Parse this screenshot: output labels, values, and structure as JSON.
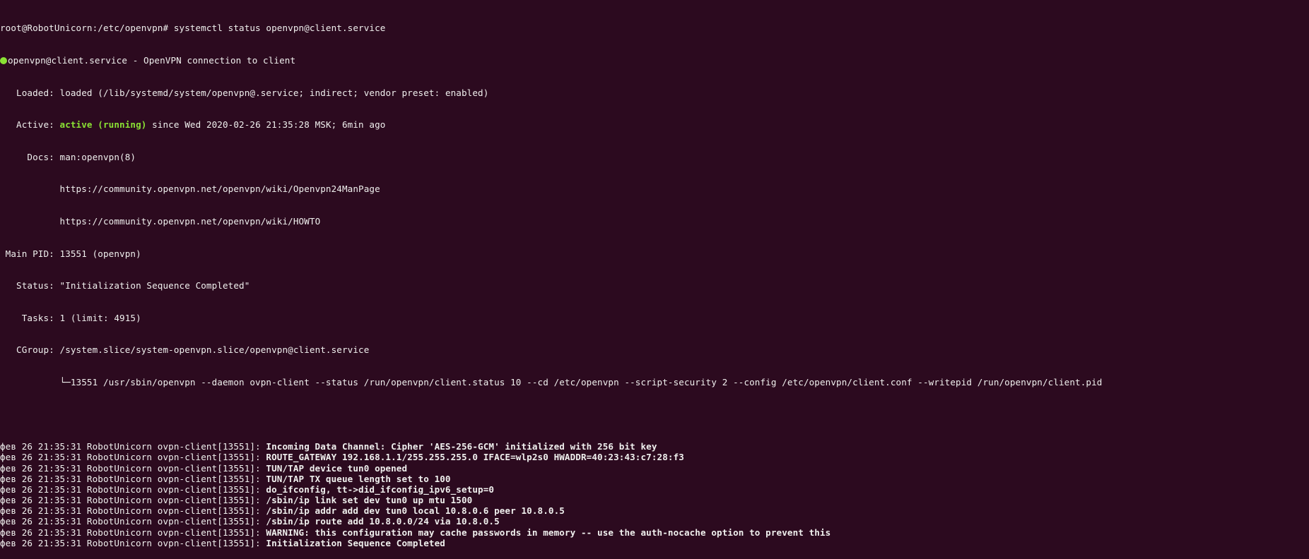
{
  "prompt": "root@RobotUnicorn:/etc/openvpn# ",
  "command": "systemctl status openvpn@client.service",
  "status_color": "#8ae234",
  "service": {
    "status_icon": "green-dot-icon",
    "header": "openvpn@client.service - OpenVPN connection to client",
    "loaded_label": "   Loaded: ",
    "loaded": "loaded (/lib/systemd/system/openvpn@.service; indirect; vendor preset: enabled)",
    "active_label": "   Active: ",
    "active_state": "active (running)",
    "active_since": " since Wed 2020-02-26 21:35:28 MSK; 6min ago",
    "docs_label": "     Docs: ",
    "docs": [
      "man:openvpn(8)",
      "https://community.openvpn.net/openvpn/wiki/Openvpn24ManPage",
      "https://community.openvpn.net/openvpn/wiki/HOWTO"
    ],
    "docs_indent": "           ",
    "main_pid_label": " Main PID: ",
    "main_pid": "13551 (openvpn)",
    "status_label": "   Status: ",
    "status": "\"Initialization Sequence Completed\"",
    "tasks_label": "    Tasks: ",
    "tasks": "1 (limit: 4915)",
    "cgroup_label": "   CGroup: ",
    "cgroup": "/system.slice/system-openvpn.slice/openvpn@client.service",
    "cgroup_process": "           └─13551 /usr/sbin/openvpn --daemon ovpn-client --status /run/openvpn/client.status 10 --cd /etc/openvpn --script-security 2 --config /etc/openvpn/client.conf --writepid /run/openvpn/client.pid"
  },
  "log_prefix": "фев 26 21:35:31 RobotUnicorn ovpn-client[13551]: ",
  "log": [
    "Incoming Data Channel: Cipher 'AES-256-GCM' initialized with 256 bit key",
    "ROUTE_GATEWAY 192.168.1.1/255.255.255.0 IFACE=wlp2s0 HWADDR=40:23:43:c7:28:f3",
    "TUN/TAP device tun0 opened",
    "TUN/TAP TX queue length set to 100",
    "do_ifconfig, tt->did_ifconfig_ipv6_setup=0",
    "/sbin/ip link set dev tun0 up mtu 1500",
    "/sbin/ip addr add dev tun0 local 10.8.0.6 peer 10.8.0.5",
    "/sbin/ip route add 10.8.0.0/24 via 10.8.0.5",
    "WARNING: this configuration may cache passwords in memory -- use the auth-nocache option to prevent this",
    "Initialization Sequence Completed"
  ]
}
